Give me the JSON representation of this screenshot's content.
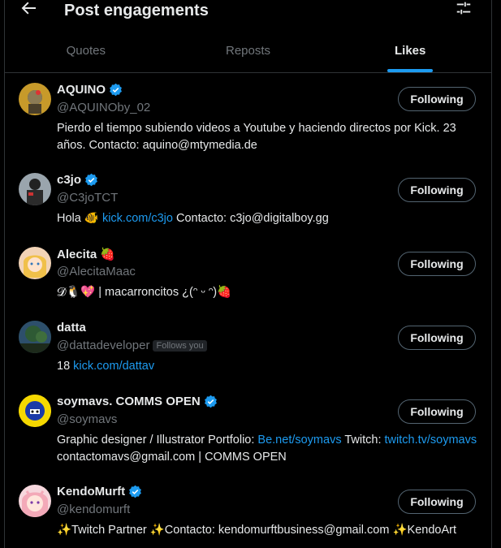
{
  "header": {
    "title": "Post engagements",
    "back_icon": "arrow-left-icon",
    "settings_icon": "sliders-icon"
  },
  "tabs": [
    {
      "label": "Quotes",
      "active": false
    },
    {
      "label": "Reposts",
      "active": false
    },
    {
      "label": "Likes",
      "active": true
    }
  ],
  "colors": {
    "accent": "#1d9bf0",
    "background": "#000000",
    "muted": "#71767b",
    "text": "#e7e9ea",
    "border": "#2f3336"
  },
  "users": [
    {
      "name": "AQUINO",
      "name_emoji": "",
      "verified": true,
      "handle": "@AQUINOby_02",
      "follows_you": "",
      "follow_label": "Following",
      "bio": [
        {
          "t": "Pierdo el tiempo subiendo videos a Youtube y haciendo directos por Kick. 23 años. Contacto: aquino@mtymedia.de",
          "link": false
        }
      ]
    },
    {
      "name": "c3jo",
      "name_emoji": "",
      "verified": true,
      "handle": "@C3joTCT",
      "follows_you": "",
      "follow_label": "Following",
      "bio": [
        {
          "t": "Hola 🐠 ",
          "link": false
        },
        {
          "t": "kick.com/c3jo",
          "link": true
        },
        {
          "t": " Contacto: c3jo@digitalboy.gg",
          "link": false
        }
      ]
    },
    {
      "name": "Alecita",
      "name_emoji": "🍓",
      "verified": false,
      "handle": "@AlecitaMaac",
      "follows_you": "",
      "follow_label": "Following",
      "bio": [
        {
          "t": "𝓓🐧💖 | macarroncitos ¿(ᵔ ᵕ ᵔ)🍓",
          "link": false
        }
      ]
    },
    {
      "name": "datta",
      "name_emoji": "",
      "verified": false,
      "handle": "@dattadeveloper",
      "follows_you": "Follows you",
      "follow_label": "Following",
      "bio": [
        {
          "t": "18 ",
          "link": false
        },
        {
          "t": "kick.com/dattav",
          "link": true
        }
      ]
    },
    {
      "name": "soymavs. COMMS OPEN",
      "name_emoji": "",
      "verified": true,
      "handle": "@soymavs",
      "follows_you": "",
      "follow_label": "Following",
      "bio": [
        {
          "t": "Graphic designer / Illustrator Portfolio: ",
          "link": false
        },
        {
          "t": "Be.net/soymavs",
          "link": true
        },
        {
          "t": " Twitch: ",
          "link": false
        },
        {
          "t": "twitch.tv/soymavs",
          "link": true
        },
        {
          "t": " contactomavs@gmail.com | COMMS OPEN",
          "link": false
        }
      ]
    },
    {
      "name": "KendoMurft",
      "name_emoji": "",
      "verified": true,
      "handle": "@kendomurft",
      "follows_you": "",
      "follow_label": "Following",
      "bio": [
        {
          "t": "✨Twitch Partner ✨Contacto: kendomurftbusiness@gmail.com ✨KendoArt",
          "link": false
        }
      ]
    }
  ]
}
